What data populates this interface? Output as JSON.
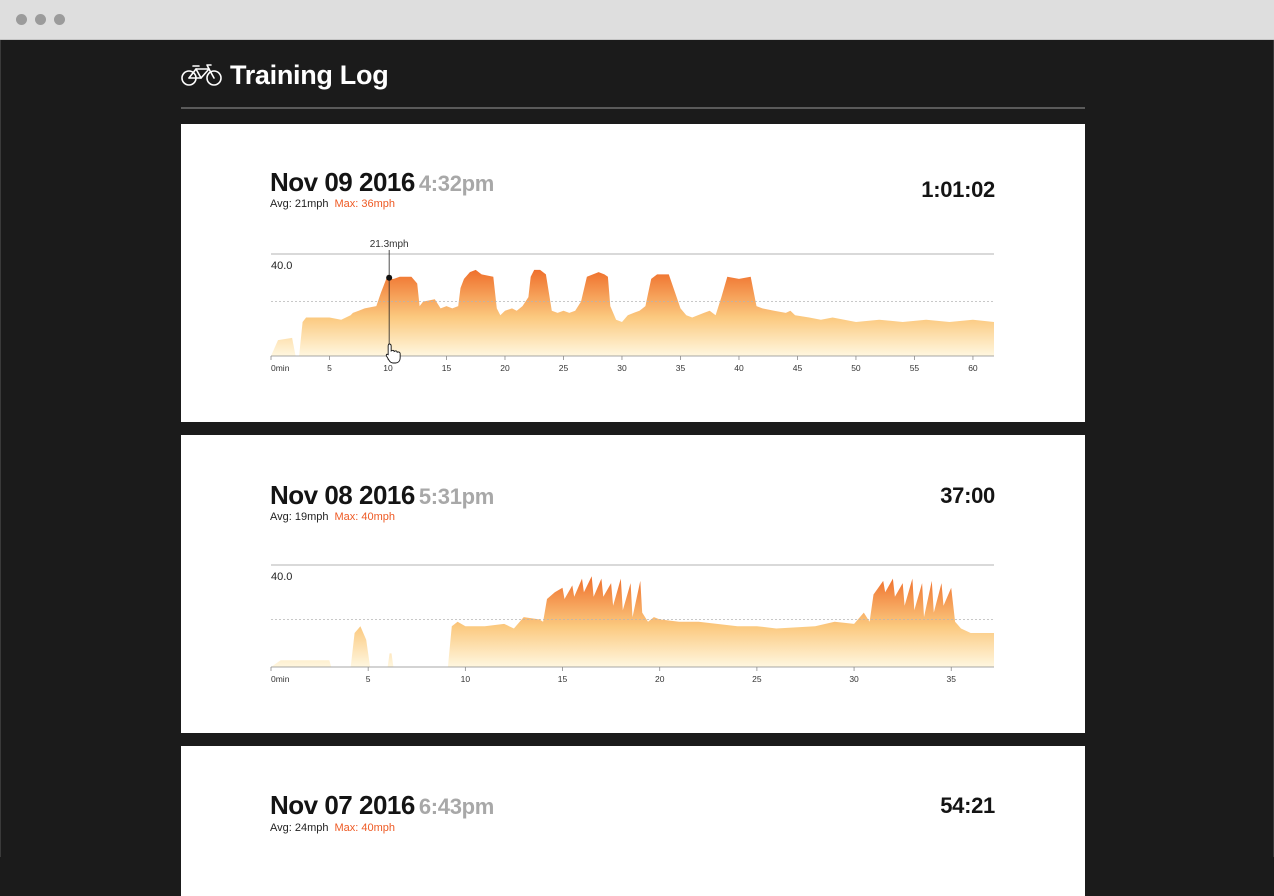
{
  "window": {
    "traffic_lights": [
      "close",
      "minimize",
      "zoom"
    ]
  },
  "app": {
    "title": "Training Log",
    "icon": "bicycle-icon"
  },
  "colors": {
    "accent": "#ee5a24",
    "gradient_top": "#ef6f2b",
    "gradient_mid": "#fbc97f",
    "gradient_bottom": "#fff7e0",
    "time_gray": "#a8a8a8"
  },
  "rides": [
    {
      "date": "Nov 09 2016",
      "time": "4:32pm",
      "avg": "Avg: 21mph",
      "max": "Max: 36mph",
      "duration": "1:01:02",
      "chart_data": {
        "type": "area",
        "xlabel": "",
        "ylabel": "",
        "y_tick_label": "40.0",
        "ylim": [
          0,
          45
        ],
        "xlim": [
          0,
          61.8
        ],
        "x_ticks": [
          0,
          5,
          10,
          15,
          20,
          25,
          30,
          35,
          40,
          45,
          50,
          55,
          60
        ],
        "x_tick_labels": [
          "0min",
          "5",
          "10",
          "15",
          "20",
          "25",
          "30",
          "35",
          "40",
          "45",
          "50",
          "55",
          "60"
        ],
        "reference_line": 24,
        "hover": {
          "x": 10.1,
          "y": 34.5,
          "label": "21.3mph"
        },
        "series": [
          {
            "x": [
              0,
              0.6,
              1.8,
              2.1,
              2.4,
              2.7,
              3,
              4,
              5,
              6,
              6.8,
              7,
              7.5,
              8,
              9,
              9.4,
              10,
              10.1,
              10.5,
              11,
              12,
              12.5,
              12.7,
              13,
              14,
              14.5,
              15,
              15.5,
              16,
              16.2,
              16.5,
              17,
              17.5,
              18,
              19,
              19.3,
              19.6,
              20,
              20.6,
              21,
              21.5,
              22,
              22.2,
              22.5,
              23,
              23.5,
              24,
              24.5,
              25,
              25.5,
              26,
              26.5,
              27,
              28,
              28.5,
              28.8,
              29,
              29.5,
              30,
              30.5,
              31,
              31.5,
              32,
              32.5,
              33,
              34,
              35,
              35.5,
              36,
              37,
              37.5,
              38,
              38.5,
              39,
              40,
              41,
              41.5,
              42,
              43,
              44,
              44.4,
              44.8,
              46,
              47,
              48,
              49,
              50,
              52,
              54,
              56,
              58,
              60,
              61.8
            ],
            "y": [
              0,
              7,
              8,
              0,
              0,
              15,
              17,
              17,
              17,
              16,
              18,
              19,
              20,
              21,
              22,
              28,
              36,
              34,
              34,
              35,
              35,
              32,
              22,
              24,
              25,
              21,
              22,
              21,
              22,
              30,
              34,
              37,
              38,
              36,
              35,
              21,
              18,
              20,
              21,
              20,
              22,
              26,
              35,
              38,
              38,
              36,
              20,
              19,
              20,
              19,
              20,
              24,
              35,
              37,
              36,
              35,
              22,
              16,
              15,
              18,
              19,
              20,
              22,
              34,
              36,
              36,
              21,
              18,
              17,
              19,
              20,
              18,
              26,
              35,
              34,
              35,
              22,
              21,
              20,
              19,
              20,
              18,
              17,
              16,
              17,
              16,
              15,
              16,
              15,
              16,
              15,
              16,
              15
            ]
          }
        ]
      }
    },
    {
      "date": "Nov 08 2016",
      "time": "5:31pm",
      "avg": "Avg: 19mph",
      "max": "Max: 40mph",
      "duration": "37:00",
      "chart_data": {
        "type": "area",
        "xlabel": "",
        "ylabel": "",
        "y_tick_label": "40.0",
        "ylim": [
          0,
          45
        ],
        "xlim": [
          0,
          37.2
        ],
        "x_ticks": [
          0,
          5,
          10,
          15,
          20,
          25,
          30,
          35
        ],
        "x_tick_labels": [
          "0min",
          "5",
          "10",
          "15",
          "20",
          "25",
          "30",
          "35"
        ],
        "reference_line": 21,
        "series": [
          {
            "x": [
              0,
              0.5,
              3,
              3.1,
              4.1,
              4.3,
              4.6,
              4.9,
              5.1,
              6.0,
              6.1,
              6.2,
              6.3,
              9.1,
              9.3,
              9.6,
              10,
              11,
              12,
              12.5,
              13,
              13.8,
              14,
              14.2,
              14.6,
              15,
              15.1,
              15.5,
              15.6,
              16,
              16.1,
              16.5,
              16.6,
              17,
              17.1,
              17.5,
              17.6,
              18,
              18.1,
              18.5,
              18.6,
              19,
              19.1,
              19.4,
              19.7,
              20,
              21,
              22,
              24,
              25,
              26,
              28,
              29,
              30,
              30.5,
              30.8,
              31.0,
              31.5,
              31.6,
              32,
              32.1,
              32.5,
              32.6,
              33,
              33.1,
              33.5,
              33.6,
              34,
              34.1,
              34.5,
              34.6,
              35,
              35.2,
              35.5,
              36,
              37.2
            ],
            "y": [
              0,
              3,
              3,
              0,
              0,
              15,
              18,
              12,
              0,
              0,
              6,
              6,
              0,
              0,
              18,
              20,
              18,
              18,
              19,
              17,
              22,
              21,
              20,
              30,
              33,
              35,
              30,
              36,
              31,
              39,
              33,
              40,
              31,
              39,
              31,
              37,
              27,
              39,
              25,
              37,
              22,
              38,
              24,
              20,
              22,
              21,
              20,
              20,
              18,
              18,
              17,
              18,
              20,
              19,
              24,
              20,
              32,
              38,
              33,
              39,
              31,
              37,
              27,
              39,
              25,
              37,
              22,
              38,
              24,
              37,
              27,
              35,
              20,
              17,
              15,
              15
            ]
          }
        ]
      }
    },
    {
      "date": "Nov 07 2016",
      "time": "6:43pm",
      "avg": "Avg: 24mph",
      "max": "Max: 40mph",
      "duration": "54:21"
    }
  ]
}
